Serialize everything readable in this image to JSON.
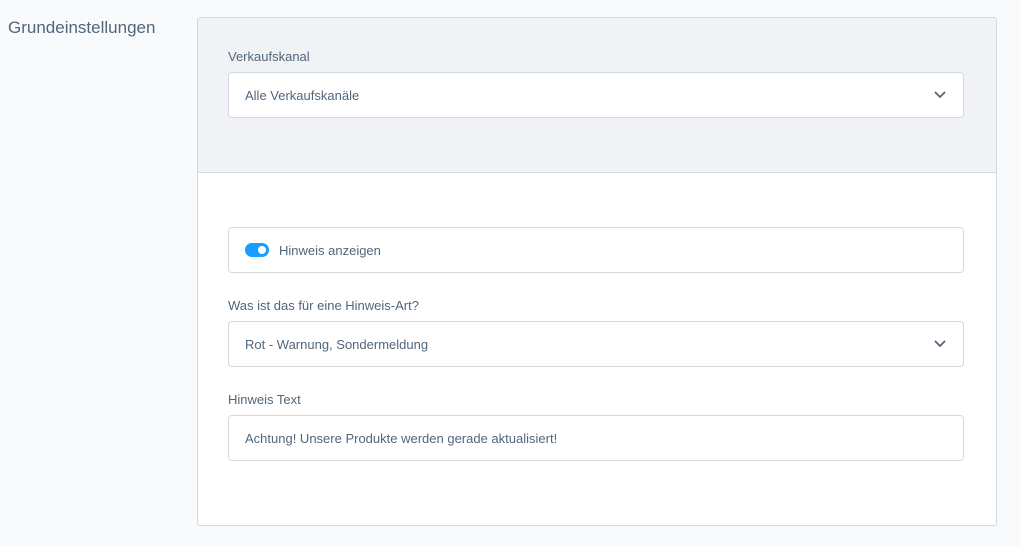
{
  "section": {
    "title": "Grundeinstellungen"
  },
  "sales_channel": {
    "label": "Verkaufskanal",
    "value": "Alle Verkaufskanäle"
  },
  "notice": {
    "toggle_label": "Hinweis anzeigen",
    "toggle_on": true,
    "type_label": "Was ist das für eine Hinweis-Art?",
    "type_value": "Rot - Warnung, Sondermeldung",
    "text_label": "Hinweis Text",
    "text_value": "Achtung! Unsere Produkte werden gerade aktualisiert!"
  },
  "colors": {
    "accent": "#189eff",
    "text": "#52667a",
    "border": "#d1d9e0",
    "header_bg": "#f0f2f5"
  },
  "icons": {
    "dropdown": "chevron-down-icon"
  }
}
